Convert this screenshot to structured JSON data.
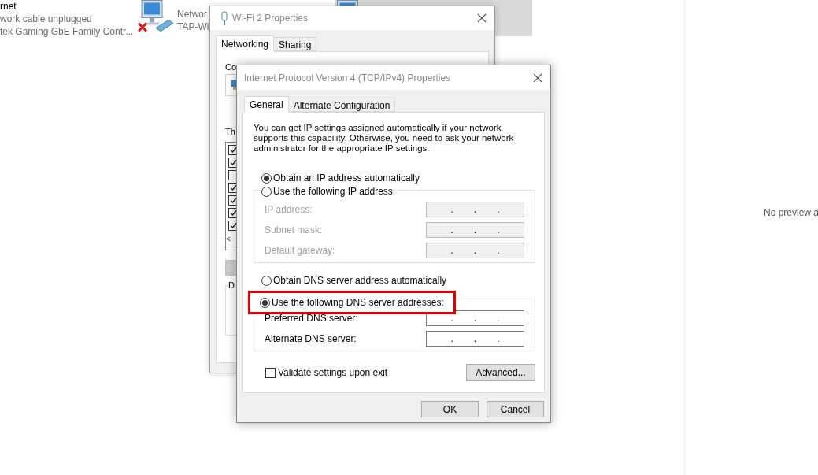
{
  "connections": [
    {
      "kind": "text_only",
      "name": "rnet",
      "status": "work cable unplugged",
      "device": "tek Gaming GbE Family Contr...",
      "selected": false
    },
    {
      "kind": "with_icon",
      "status": "Networ",
      "device": "TAP-Wi",
      "selected": false
    },
    {
      "kind": "with_icon",
      "selected": true
    }
  ],
  "preview": {
    "text": "No preview a"
  },
  "wifi_properties": {
    "title": "Wi-Fi 2 Properties",
    "tabs": [
      {
        "label": "Networking",
        "selected": true
      },
      {
        "label": "Sharing",
        "selected": false
      }
    ],
    "connect_label": "Co",
    "items_label": "Th",
    "components": [
      {
        "checked": true
      },
      {
        "checked": true
      },
      {
        "checked": false
      },
      {
        "checked": true
      },
      {
        "checked": true
      },
      {
        "checked": true
      },
      {
        "checked": true
      }
    ],
    "scroll_glyph": "<",
    "group_label": "D"
  },
  "ipv4_properties": {
    "title": "Internet Protocol Version 4 (TCP/IPv4) Properties",
    "tabs": [
      {
        "label": "General",
        "selected": true
      },
      {
        "label": "Alternate Configuration",
        "selected": false
      }
    ],
    "intro": "You can get IP settings assigned automatically if your network supports this capability. Otherwise, you need to ask your network administrator for the appropriate IP settings.",
    "ip_options": [
      {
        "label": "Obtain an IP address automatically",
        "selected": true,
        "highlighted": false
      },
      {
        "label": "Use the following IP address:",
        "selected": false,
        "highlighted": false
      }
    ],
    "ip_fields": [
      {
        "label": "IP address:",
        "value": "...",
        "disabled": true
      },
      {
        "label": "Subnet mask:",
        "value": "...",
        "disabled": true
      },
      {
        "label": "Default gateway:",
        "value": "...",
        "disabled": true
      }
    ],
    "dns_options": [
      {
        "label": "Obtain DNS server address automatically",
        "selected": false,
        "highlighted": false
      },
      {
        "label": "Use the following DNS server addresses:",
        "selected": true,
        "highlighted": true
      }
    ],
    "dns_fields": [
      {
        "label": "Preferred DNS server:",
        "value": "...",
        "disabled": false
      },
      {
        "label": "Alternate DNS server:",
        "value": "...",
        "disabled": false
      }
    ],
    "validate": {
      "label": "Validate settings upon exit",
      "checked": false
    },
    "advanced_button": "Advanced...",
    "buttons": [
      "OK",
      "Cancel"
    ]
  }
}
